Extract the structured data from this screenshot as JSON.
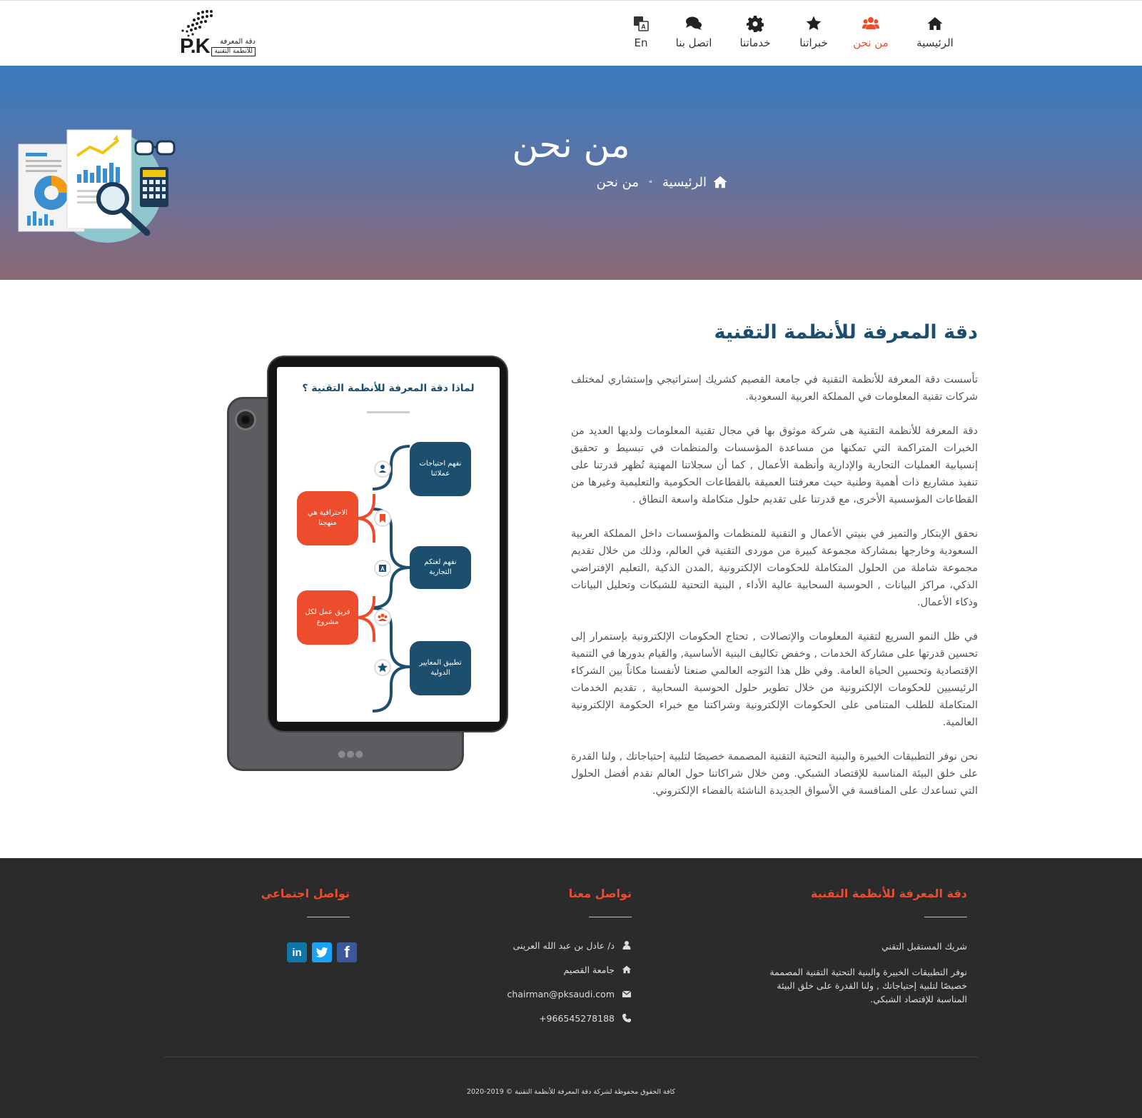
{
  "header": {
    "logo": {
      "mark": "P.K",
      "name_line1": "دقة المعرفة",
      "name_line2": "للأنظمة التقنية"
    },
    "nav": [
      {
        "label": "الرئيسية",
        "icon": "home-icon",
        "active": false
      },
      {
        "label": "من نحن",
        "icon": "users-icon",
        "active": true
      },
      {
        "label": "خبراتنا",
        "icon": "star-icon",
        "active": false
      },
      {
        "label": "خدماتنا",
        "icon": "gear-icon",
        "active": false
      },
      {
        "label": "اتصل بنا",
        "icon": "chat-icon",
        "active": false
      },
      {
        "label": "En",
        "icon": "translate-icon",
        "active": false
      }
    ]
  },
  "banner": {
    "title": "من نحن",
    "breadcrumb": {
      "home": "الرئيسية",
      "separator": "»",
      "current": "من نحن"
    },
    "illustration": "analytics-illustration"
  },
  "content": {
    "title": "دقة المعرفة للأنظمة التقنية",
    "paragraphs": [
      "تأسست دقة المعرفة للأنظمة التقنية في جامعة القصيم كشريك إستراتيجي وإستشاري لمختلف شركات تقنية المعلومات في المملكة العربية السعودية.",
      "دقة المعرفة للأنظمة التقنية هى شركة موثوق بها في مجال تقنية المعلومات ولديها العديد من الخبرات المتراكمة التي تمكنها من مساعدة المؤسسات والمنظمات في تبسيط و تحقيق إنسيابية العمليات التجارية والإدارية وأنظمة الأعمال , كما أن سجلاتنا المهنية تُظهر قدرتنا على تنفيذ مشاريع ذات أهمية وطنية حيث معرفتنا العميقة بالقطاعات الحكومية والتعليمية وغيرها من القطاعات المؤسسية الأخرى، مع قدرتنا على تقديم حلول متكاملة واسعة النطاق .",
      "نحقق الإبتكار والتميز في بنيتي الأعمال و التقنية للمنظمات والمؤسسات داخل المملكة العربية السعودية وخارجها بمشاركة مجموعة كبيرة من موردى التقنية في العالم، وذلك من خلال تقديم مجموعة شاملة من الحلول المتكاملة للحكومات الإلكترونية ,المدن الذكية ,التعليم الإفتراضي الذكي، مراكز البيانات , الحوسبة السحابية عالية الأداء , البنية التحتية للشبكات وتحليل البيانات وذكاء الأعمال.",
      "في ظل النمو السريع لتقنية المعلومات والإتصالات , تحتاج الحكومات الإلكترونية بإستمرار إلى تحسين قدرتها على مشاركة الخدمات , وخفض تكاليف البنية الأساسية, والقيام بدورها في التنمية الإقتصادية وتحسين الحياة العامة. وفي ظل هذا التوجه العالمي صنعنا لأنفسنا مكاناً بين الشركاء الرئيسيين للحكومات الإلكترونية من خلال تطوير حلول الحوسبة السحابية , تقديم الخدمات المتكاملة للطلب المتنامى على الحكومات الإلكترونية وشراكتنا مع خبراء الحكومة الإلكترونية العالمية.",
      "نحن نوفر التطبيقات الخبيرة والبنية التحتية التقنية المصممة خصيصًا لتلبية إحتياجاتك , ولنا القدرة على خلق البيئة المناسبة للإقتصاد الشبكي. ومن خلال شراكاتنا حول العالم نقدم أفضل الحلول التي تساعدك على المنافسة في الأسواق الجديدة الناشئة بالفضاء الإلكتروني."
    ],
    "tablet": {
      "title": "لماذا دقة المعرفة للأنظمة التقنية ؟",
      "items": [
        {
          "label": "نفهم احتياجات عملائنا",
          "color": "blue",
          "icon": "user-icon"
        },
        {
          "label": "الاحترافية هي منهجنا",
          "color": "orange",
          "icon": "bookmark-icon"
        },
        {
          "label": "نفهم لغتكم التجارية",
          "color": "blue",
          "icon": "letter-icon"
        },
        {
          "label": "فريق عمل لكل مشروع",
          "color": "orange",
          "icon": "team-icon"
        },
        {
          "label": "تطبيق المعايير الدولية",
          "color": "blue",
          "icon": "star-icon"
        }
      ]
    }
  },
  "footer": {
    "about": {
      "title": "دقة المعرفة للأنظمة التقنية",
      "tagline": "شريك المستقبل التقني",
      "description": "نوفر التطبيقات الخبيرة والبنية التحتية التقنية المصممة خصيصًا لتلبية إحتياجاتك , ولنا القدرة على خلق البيئة المناسبة للإقتصاد الشبكي."
    },
    "contact": {
      "title": "تواصل معنا",
      "person": "د/ عادل بن عبد الله العرينى",
      "address": "جامعة القصيم",
      "email": "chairman@pksaudi.com",
      "phone": "+966545278188"
    },
    "social": {
      "title": "تواصل اجتماعي",
      "links": [
        {
          "name": "facebook",
          "glyph": "f"
        },
        {
          "name": "twitter",
          "glyph": "t"
        },
        {
          "name": "linkedin",
          "glyph": "in"
        }
      ]
    },
    "copyright": "كافة الحقوق محفوظة لشركة دقة المعرفة للأنظمة التقنية © 2019-2020"
  },
  "colors": {
    "brand_dark": "#1c4e6e",
    "accent": "#ee4d2d",
    "footer_bg": "#2b2b2b"
  }
}
